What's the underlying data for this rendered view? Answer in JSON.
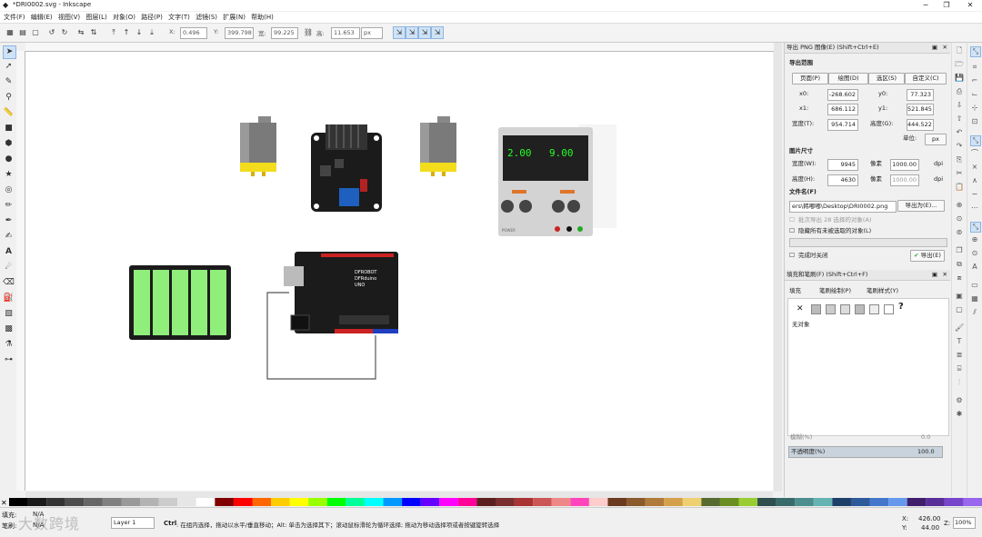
{
  "window": {
    "title": "*DRI0002.svg - Inkscape",
    "minimize": "─",
    "maximize": "❐",
    "close": "✕"
  },
  "menu": [
    "文件(F)",
    "编辑(E)",
    "视图(V)",
    "图层(L)",
    "对象(O)",
    "路径(P)",
    "文字(T)",
    "滤镜(S)",
    "扩展(N)",
    "帮助(H)"
  ],
  "toolbar": {
    "x_label": "X:",
    "x_value": "0.496",
    "y_label": "Y:",
    "y_value": "399.798",
    "w_label": "宽:",
    "w_value": "99.225",
    "h_label": "高:",
    "h_value": "11.653",
    "unit": "px"
  },
  "export_panel": {
    "title": "导出 PNG 图像(E) (Shift+Ctrl+E)",
    "area_heading": "导出范围",
    "area_buttons": [
      "页面(P)",
      "绘图(D)",
      "选区(S)",
      "自定义(C)"
    ],
    "x0_label": "x0:",
    "x0": "-268.602",
    "y0_label": "y0:",
    "y0": "77.323",
    "x1_label": "x1:",
    "x1": "686.112",
    "y1_label": "y1:",
    "y1": "521.845",
    "width_label": "宽度(T):",
    "width": "954.714",
    "height_label": "高度(G):",
    "height": "444.522",
    "units_label": "单位:",
    "units": "px",
    "image_size_heading": "图片尺寸",
    "img_width_label": "宽度(W):",
    "img_width": "9945",
    "img_height_label": "高度(H):",
    "img_height": "4630",
    "pixels_at": "像素",
    "dpi_value": "1000.00",
    "dpi": "dpi",
    "filename_heading": "文件名(F)",
    "filename": "ers\\韩嘟嘟\\Desktop\\DRI0002.png",
    "export_as": "导出为(E)...",
    "batch_label": "批次导出 28 选择的对象(A)",
    "hide_label": "隐藏所有未被选取的对象(L)",
    "close_when_done": "完成时关闭",
    "export_button": "导出(E)"
  },
  "fill_panel": {
    "title": "填充和笔刷(F) (Shift+Ctrl+F)",
    "tabs": [
      "填充",
      "笔刷绘制(P)",
      "笔刷样式(Y)"
    ],
    "no_object": "无对象",
    "unknown_icon_text": "?",
    "blur_label": "模糊(%)",
    "blur_value": "0.0",
    "opacity_label": "不透明度(%)",
    "opacity_value": "100.0"
  },
  "power_supply": {
    "left_display": "2.00",
    "right_display": "9.00",
    "brand": "POWER"
  },
  "arduino_label": {
    "line1": "DFROBOT",
    "line2": "DFRduino",
    "line3": "UNO"
  },
  "status": {
    "fill_label": "填充:",
    "fill_value": "N/A",
    "stroke_label": "笔刷:",
    "stroke_value": "N/A",
    "layer": "Layer 1",
    "message_key": "Ctrl",
    "message": ": 在组内选择，拖动以水平/垂直移动；Alt: 单击为选择其下；滚动鼠标滑轮为循环选择; 拖动为移动选择项或者按键旋转选择",
    "x_label": "X:",
    "x_value": "426.00",
    "y_label": "Y:",
    "y_value": "44.00",
    "zoom_label": "Z:",
    "zoom_value": "100%",
    "watermark": "大数跨境"
  },
  "colors": {
    "accent": "#cfe3f7",
    "battery": "#90ee7a",
    "board": "#1b1b1b",
    "motor_yellow": "#f2dc1c",
    "segment_green": "#22ff22"
  }
}
